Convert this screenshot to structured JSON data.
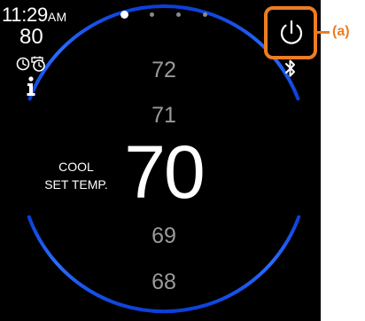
{
  "status": {
    "time": "11:29",
    "ampm": "AM",
    "outdoor_temp": "80",
    "icons": [
      "schedule-clock-icon",
      "schedule-calendar-icon",
      "info-icon"
    ]
  },
  "pager": {
    "pages": 4,
    "active_index": 0
  },
  "header": {
    "power_icon": "power-icon",
    "bluetooth_icon": "bluetooth-icon",
    "callout_label": "(a)"
  },
  "setpoint": {
    "mode_line1": "COOL",
    "mode_line2": "SET TEMP.",
    "current": "70",
    "above": [
      "72",
      "71"
    ],
    "below": [
      "69",
      "68"
    ]
  },
  "colors": {
    "background": "#000000",
    "arc_accent": "#1a5cf0",
    "highlight": "#ec7d22",
    "dim_text": "#9a9a9a",
    "text": "#ffffff"
  }
}
